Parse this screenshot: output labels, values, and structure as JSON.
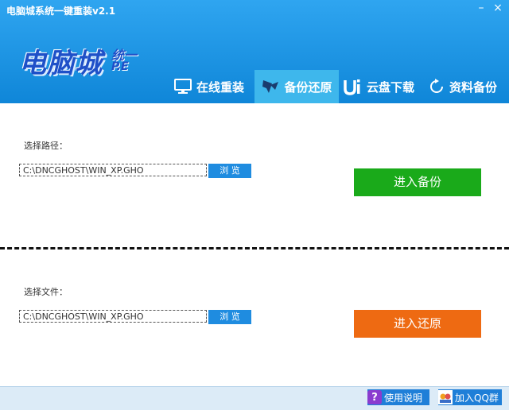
{
  "window": {
    "title": "电脑城系统一键重装v2.1",
    "minimize": "–",
    "close": "×"
  },
  "logo": {
    "main": "电脑城",
    "sup": "统一",
    "ver": "P.E"
  },
  "tabs": [
    {
      "label": "在线重装",
      "icon": "monitor-icon"
    },
    {
      "label": "备份还原",
      "icon": "backup-icon"
    },
    {
      "label": "云盘下载",
      "icon": "ui-icon"
    },
    {
      "label": "资料备份",
      "icon": "refresh-icon"
    }
  ],
  "backup": {
    "label": "选择路径：",
    "path": "C:\\DNCGHOST\\WIN_XP.GHO",
    "browse": "浏 览",
    "button": "进入备份"
  },
  "restore": {
    "label": "选择文件：",
    "path": "C:\\DNCGHOST\\WIN_XP.GHO",
    "browse": "浏 览",
    "button": "进入还原"
  },
  "footer": {
    "help": {
      "icon": "?",
      "label": "使用说明"
    },
    "qq": {
      "label": "加入QQ群"
    }
  },
  "colors": {
    "header": "#1a8fe0",
    "active_tab": "#3eb7ec",
    "backup_button": "#1aaa1a",
    "restore_button": "#ee6a12",
    "browse": "#1f8ce0"
  }
}
